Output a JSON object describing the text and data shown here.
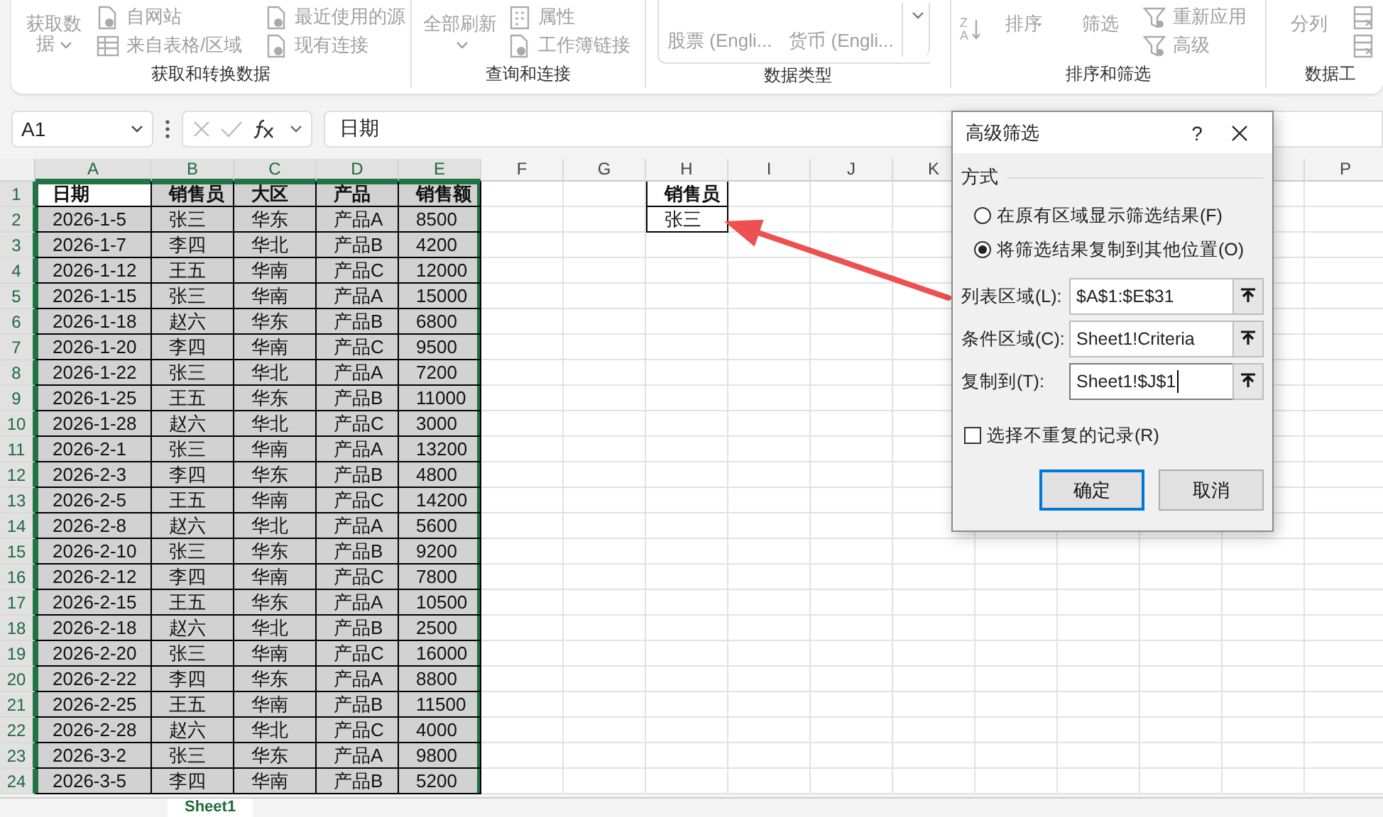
{
  "ribbon": {
    "groups": [
      {
        "label": "获取和转换数据",
        "columns": [
          [
            {
              "kind": "split",
              "label": "获取数据"
            }
          ],
          [
            {
              "kind": "small",
              "label": "自网站"
            },
            {
              "kind": "small",
              "label": "来自表格/区域"
            }
          ],
          [
            {
              "kind": "small",
              "label": "最近使用的源"
            },
            {
              "kind": "small",
              "label": "现有连接"
            }
          ]
        ]
      },
      {
        "label": "查询和连接",
        "columns": [
          [
            {
              "kind": "split",
              "label": "全部刷新"
            }
          ],
          [
            {
              "kind": "small",
              "label": "属性"
            },
            {
              "kind": "small",
              "label": "工作簿链接"
            }
          ]
        ]
      },
      {
        "label": "数据类型",
        "columns": [
          [
            {
              "kind": "gallery",
              "label": "股票 (Engli..."
            }
          ],
          [
            {
              "kind": "gallery",
              "label": "货币 (Engli..."
            }
          ],
          [
            {
              "kind": "more"
            }
          ]
        ]
      },
      {
        "label": "排序和筛选",
        "columns": [
          [
            {
              "kind": "sort",
              "top": "Z",
              "bottom": "A"
            }
          ],
          [
            {
              "kind": "large",
              "label": "排序"
            }
          ],
          [
            {
              "kind": "large",
              "label": "筛选"
            }
          ],
          [
            {
              "kind": "small",
              "label": "重新应用"
            },
            {
              "kind": "small",
              "label": "高级"
            }
          ]
        ]
      },
      {
        "label": "数据工",
        "columns": [
          [
            {
              "kind": "large",
              "label": "分列"
            }
          ],
          [
            {
              "kind": "icon"
            },
            {
              "kind": "icon"
            }
          ]
        ]
      }
    ]
  },
  "formula_bar": {
    "name_box": "A1",
    "formula": "日期"
  },
  "sheet": {
    "columns": [
      {
        "label": "A",
        "selected": true
      },
      {
        "label": "B",
        "selected": true
      },
      {
        "label": "C",
        "selected": true
      },
      {
        "label": "D",
        "selected": true
      },
      {
        "label": "E",
        "selected": true
      },
      {
        "label": "F",
        "selected": false
      },
      {
        "label": "G",
        "selected": false
      },
      {
        "label": "H",
        "selected": false
      },
      {
        "label": "I",
        "selected": false
      },
      {
        "label": "J",
        "selected": false
      },
      {
        "label": "K",
        "selected": false
      },
      {
        "label": "P",
        "selected": false
      }
    ],
    "rows": [
      {
        "number": "1",
        "selected": true,
        "kind": "header",
        "cells": [
          "日期",
          "销售员",
          "大区",
          "产品",
          "销售额"
        ]
      },
      {
        "number": "2",
        "selected": true,
        "kind": "data",
        "cells": [
          "2026-1-5",
          "张三",
          "华东",
          "产品A",
          "8500"
        ]
      },
      {
        "number": "3",
        "selected": true,
        "kind": "data",
        "cells": [
          "2026-1-7",
          "李四",
          "华北",
          "产品B",
          "4200"
        ]
      },
      {
        "number": "4",
        "selected": true,
        "kind": "data",
        "cells": [
          "2026-1-12",
          "王五",
          "华南",
          "产品C",
          "12000"
        ]
      },
      {
        "number": "5",
        "selected": true,
        "kind": "data",
        "cells": [
          "2026-1-15",
          "张三",
          "华南",
          "产品A",
          "15000"
        ]
      },
      {
        "number": "6",
        "selected": true,
        "kind": "data",
        "cells": [
          "2026-1-18",
          "赵六",
          "华东",
          "产品B",
          "6800"
        ]
      },
      {
        "number": "7",
        "selected": true,
        "kind": "data",
        "cells": [
          "2026-1-20",
          "李四",
          "华南",
          "产品C",
          "9500"
        ]
      },
      {
        "number": "8",
        "selected": true,
        "kind": "data",
        "cells": [
          "2026-1-22",
          "张三",
          "华北",
          "产品A",
          "7200"
        ]
      },
      {
        "number": "9",
        "selected": true,
        "kind": "data",
        "cells": [
          "2026-1-25",
          "王五",
          "华东",
          "产品B",
          "11000"
        ]
      },
      {
        "number": "10",
        "selected": true,
        "kind": "data",
        "cells": [
          "2026-1-28",
          "赵六",
          "华北",
          "产品C",
          "3000"
        ]
      },
      {
        "number": "11",
        "selected": true,
        "kind": "data",
        "cells": [
          "2026-2-1",
          "张三",
          "华南",
          "产品A",
          "13200"
        ]
      },
      {
        "number": "12",
        "selected": true,
        "kind": "data",
        "cells": [
          "2026-2-3",
          "李四",
          "华东",
          "产品B",
          "4800"
        ]
      },
      {
        "number": "13",
        "selected": true,
        "kind": "data",
        "cells": [
          "2026-2-5",
          "王五",
          "华南",
          "产品C",
          "14200"
        ]
      },
      {
        "number": "14",
        "selected": true,
        "kind": "data",
        "cells": [
          "2026-2-8",
          "赵六",
          "华北",
          "产品A",
          "5600"
        ]
      },
      {
        "number": "15",
        "selected": true,
        "kind": "data",
        "cells": [
          "2026-2-10",
          "张三",
          "华东",
          "产品B",
          "9200"
        ]
      },
      {
        "number": "16",
        "selected": true,
        "kind": "data",
        "cells": [
          "2026-2-12",
          "李四",
          "华南",
          "产品C",
          "7800"
        ]
      },
      {
        "number": "17",
        "selected": true,
        "kind": "data",
        "cells": [
          "2026-2-15",
          "王五",
          "华东",
          "产品A",
          "10500"
        ]
      },
      {
        "number": "18",
        "selected": true,
        "kind": "data",
        "cells": [
          "2026-2-18",
          "赵六",
          "华北",
          "产品B",
          "2500"
        ]
      },
      {
        "number": "19",
        "selected": true,
        "kind": "data",
        "cells": [
          "2026-2-20",
          "张三",
          "华南",
          "产品C",
          "16000"
        ]
      },
      {
        "number": "20",
        "selected": true,
        "kind": "data",
        "cells": [
          "2026-2-22",
          "李四",
          "华东",
          "产品A",
          "8800"
        ]
      },
      {
        "number": "21",
        "selected": true,
        "kind": "data",
        "cells": [
          "2026-2-25",
          "王五",
          "华南",
          "产品B",
          "11500"
        ]
      },
      {
        "number": "22",
        "selected": true,
        "kind": "data",
        "cells": [
          "2026-2-28",
          "赵六",
          "华北",
          "产品C",
          "4000"
        ]
      },
      {
        "number": "23",
        "selected": true,
        "kind": "data",
        "cells": [
          "2026-3-2",
          "张三",
          "华东",
          "产品A",
          "9800"
        ]
      },
      {
        "number": "24",
        "selected": true,
        "kind": "data",
        "cells": [
          "2026-3-5",
          "李四",
          "华南",
          "产品B",
          "5200"
        ]
      }
    ],
    "criteria": {
      "header": "销售员",
      "value": "张三"
    }
  },
  "dialog": {
    "title": "高级筛选",
    "help": "?",
    "section": "方式",
    "options": [
      {
        "label": "在原有区域显示筛选结果(F)",
        "selected": false
      },
      {
        "label": "将筛选结果复制到其他位置(O)",
        "selected": true
      }
    ],
    "fields": [
      {
        "label": "列表区域(L):",
        "value": "$A$1:$E$31",
        "focused": false
      },
      {
        "label": "条件区域(C):",
        "value": "Sheet1!Criteria",
        "focused": false
      },
      {
        "label": "复制到(T):",
        "value": "Sheet1!$J$1",
        "focused": true
      }
    ],
    "unique": {
      "label": "选择不重复的记录(R)",
      "checked": false
    },
    "buttons": [
      {
        "label": "确定",
        "default": true
      },
      {
        "label": "取消",
        "default": false
      }
    ]
  },
  "sheet_tabs": [
    {
      "label": "Sheet1",
      "selected": true
    }
  ]
}
